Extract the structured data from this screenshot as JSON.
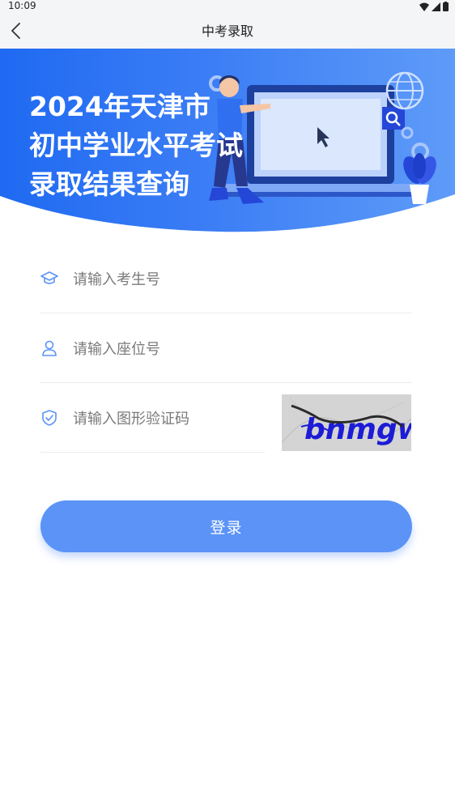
{
  "status_bar": {
    "time": "10:09"
  },
  "nav": {
    "title": "中考录取"
  },
  "banner": {
    "headline_lines": [
      "2024年天津市",
      "初中学业水平考试",
      "录取结果查询"
    ]
  },
  "form": {
    "exam_number": {
      "placeholder": "请输入考生号",
      "icon": "graduation-cap-icon"
    },
    "seat_number": {
      "placeholder": "请输入座位号",
      "icon": "user-icon"
    },
    "captcha": {
      "placeholder": "请输入图形验证码",
      "icon": "shield-check-icon",
      "image_text": "bnmgw"
    }
  },
  "login_button": {
    "label": "登录"
  },
  "colors": {
    "primary": "#5b93f7",
    "banner_blue": "#2f6ff0",
    "nav_bg": "#f4f5f7"
  }
}
